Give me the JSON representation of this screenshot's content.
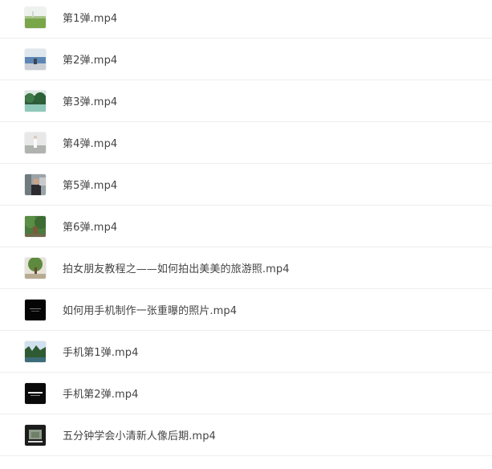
{
  "files": [
    {
      "name": "第1弹.mp4",
      "thumbnail": "video-thumbnail-green-field"
    },
    {
      "name": "第2弹.mp4",
      "thumbnail": "video-thumbnail-seaside"
    },
    {
      "name": "第3弹.mp4",
      "thumbnail": "video-thumbnail-trees-court"
    },
    {
      "name": "第4弹.mp4",
      "thumbnail": "video-thumbnail-white-figure"
    },
    {
      "name": "第5弹.mp4",
      "thumbnail": "video-thumbnail-man-portrait"
    },
    {
      "name": "第6弹.mp4",
      "thumbnail": "video-thumbnail-tree-person"
    },
    {
      "name": "拍女朋友教程之——如何拍出美美的旅游照.mp4",
      "thumbnail": "video-thumbnail-tree-street"
    },
    {
      "name": "如何用手机制作一张重曝的照片.mp4",
      "thumbnail": "video-thumbnail-black-title"
    },
    {
      "name": "手机第1弹.mp4",
      "thumbnail": "video-thumbnail-forest-sky"
    },
    {
      "name": "手机第2弹.mp4",
      "thumbnail": "video-thumbnail-black-text"
    },
    {
      "name": "五分钟学会小清新人像后期.mp4",
      "thumbnail": "video-thumbnail-dark-frame"
    }
  ]
}
